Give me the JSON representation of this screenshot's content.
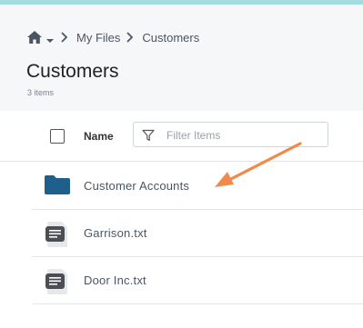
{
  "breadcrumb": {
    "home_icon": "home-icon",
    "items": [
      "My Files",
      "Customers"
    ]
  },
  "page": {
    "title": "Customers",
    "item_count": "3 items"
  },
  "columns": {
    "name_header": "Name",
    "filter_placeholder": "Filter Items",
    "filter_value": ""
  },
  "rows": [
    {
      "name": "Customer Accounts",
      "type": "folder",
      "icon": "folder-icon"
    },
    {
      "name": "Garrison.txt",
      "type": "text-file",
      "icon": "text-file-icon"
    },
    {
      "name": "Door Inc.txt",
      "type": "text-file",
      "icon": "text-file-icon"
    }
  ],
  "colors": {
    "accent_bar": "#a3dcdf",
    "folder": "#1f5f8b",
    "annotation_arrow": "#f08a4b"
  }
}
